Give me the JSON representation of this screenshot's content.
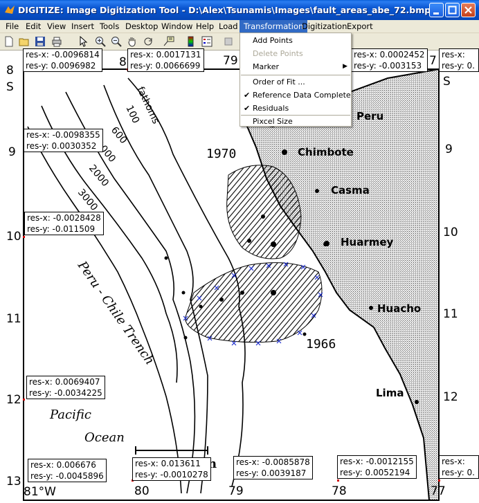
{
  "window": {
    "title": "DIGITIZE: Image Digitization Tool - D:\\Alex\\Tsunamis\\Images\\fault_areas_abe_72.bmp"
  },
  "menu": [
    "File",
    "Edit",
    "View",
    "Insert",
    "Tools",
    "Desktop",
    "Window",
    "Help",
    "Load",
    "Transformation",
    "Digitization",
    "Export"
  ],
  "dropdown": {
    "items": [
      {
        "label": "Add Points",
        "enabled": true,
        "checked": false
      },
      {
        "label": "Delete Points",
        "enabled": false,
        "checked": false
      },
      {
        "label": "Marker",
        "enabled": true,
        "checked": false,
        "submenu": true
      },
      {
        "label": "Order of Fit ...",
        "enabled": true,
        "checked": false
      },
      {
        "label": "Reference Data Complete",
        "enabled": true,
        "checked": true
      },
      {
        "label": "Residuals",
        "enabled": true,
        "checked": true
      },
      {
        "label": "Pixcel Size",
        "enabled": true,
        "checked": false
      }
    ]
  },
  "residuals": [
    {
      "rx": "res-x: -0.0096814",
      "ry": "res-y: 0.0096982"
    },
    {
      "rx": "res-x: 0.0017131",
      "ry": "res-y: 0.0066699"
    },
    {
      "rx": "res-x: 0.0002452",
      "ry": "res-y: -0.003153"
    },
    {
      "rx": "res-x:",
      "ry": "res-y: 0."
    },
    {
      "rx": "res-x: -0.0098355",
      "ry": "res-y: 0.0030352"
    },
    {
      "rx": "res-x: -0.0028428",
      "ry": "res-y: -0.011509"
    },
    {
      "rx": "res-x: 0.0069407",
      "ry": "res-y: -0.0034225"
    },
    {
      "rx": "res-x: 0.006676",
      "ry": "res-y: -0.0045896"
    },
    {
      "rx": "res-x: 0.013611",
      "ry": "res-y: -0.0010278"
    },
    {
      "rx": "res-x: -0.0085878",
      "ry": "res-y: 0.0039187"
    },
    {
      "rx": "res-x: -0.0012155",
      "ry": "res-y: 0.0052194"
    },
    {
      "rx": "res-x:",
      "ry": "res-y: 0."
    }
  ],
  "map": {
    "lat_labels_left": [
      "8",
      "S",
      "9",
      "10",
      "11",
      "12",
      "13"
    ],
    "lat_labels_right": [
      "7",
      "S",
      "9",
      "10",
      "11",
      "12"
    ],
    "lon_labels_top": [
      "8",
      "79",
      "7"
    ],
    "lon_labels_bottom": [
      "81°W",
      "80",
      "79",
      "78",
      "77"
    ],
    "places": [
      "Peru",
      "Chimbote",
      "Casma",
      "Huarmey",
      "Huacho",
      "Lima"
    ],
    "years": [
      "1970",
      "1966"
    ],
    "depths": [
      "fathoms",
      "100",
      "600",
      "1000",
      "2000",
      "3000"
    ],
    "features": [
      "Peru - Chile Trench",
      "Pacific",
      "Ocean"
    ],
    "scale_unit": "n"
  },
  "colors": {
    "titlebar": "#0a5fd8",
    "menu_highlight": "#316ac5",
    "marker_blue": "#1f2fd0",
    "point_red": "#d00000"
  }
}
